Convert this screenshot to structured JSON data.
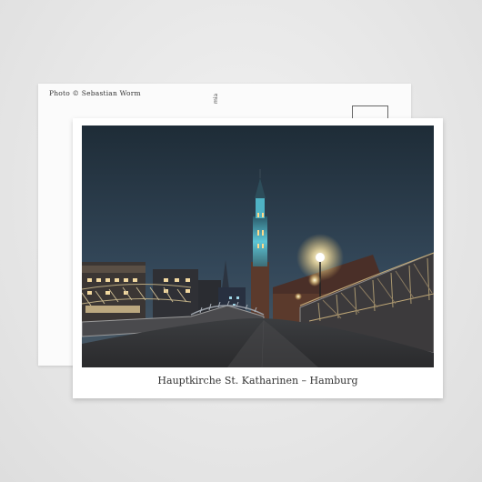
{
  "back": {
    "credit": "Photo © Sebastian Worm",
    "rotated_text": "mia"
  },
  "front": {
    "caption": "Hauptkirche St. Katharinen – Hamburg"
  },
  "colors": {
    "sky_top": "#243340",
    "sky_bottom": "#3a4c5a",
    "tower_glow": "#5fd0e0",
    "lamp": "#fff4d0"
  }
}
